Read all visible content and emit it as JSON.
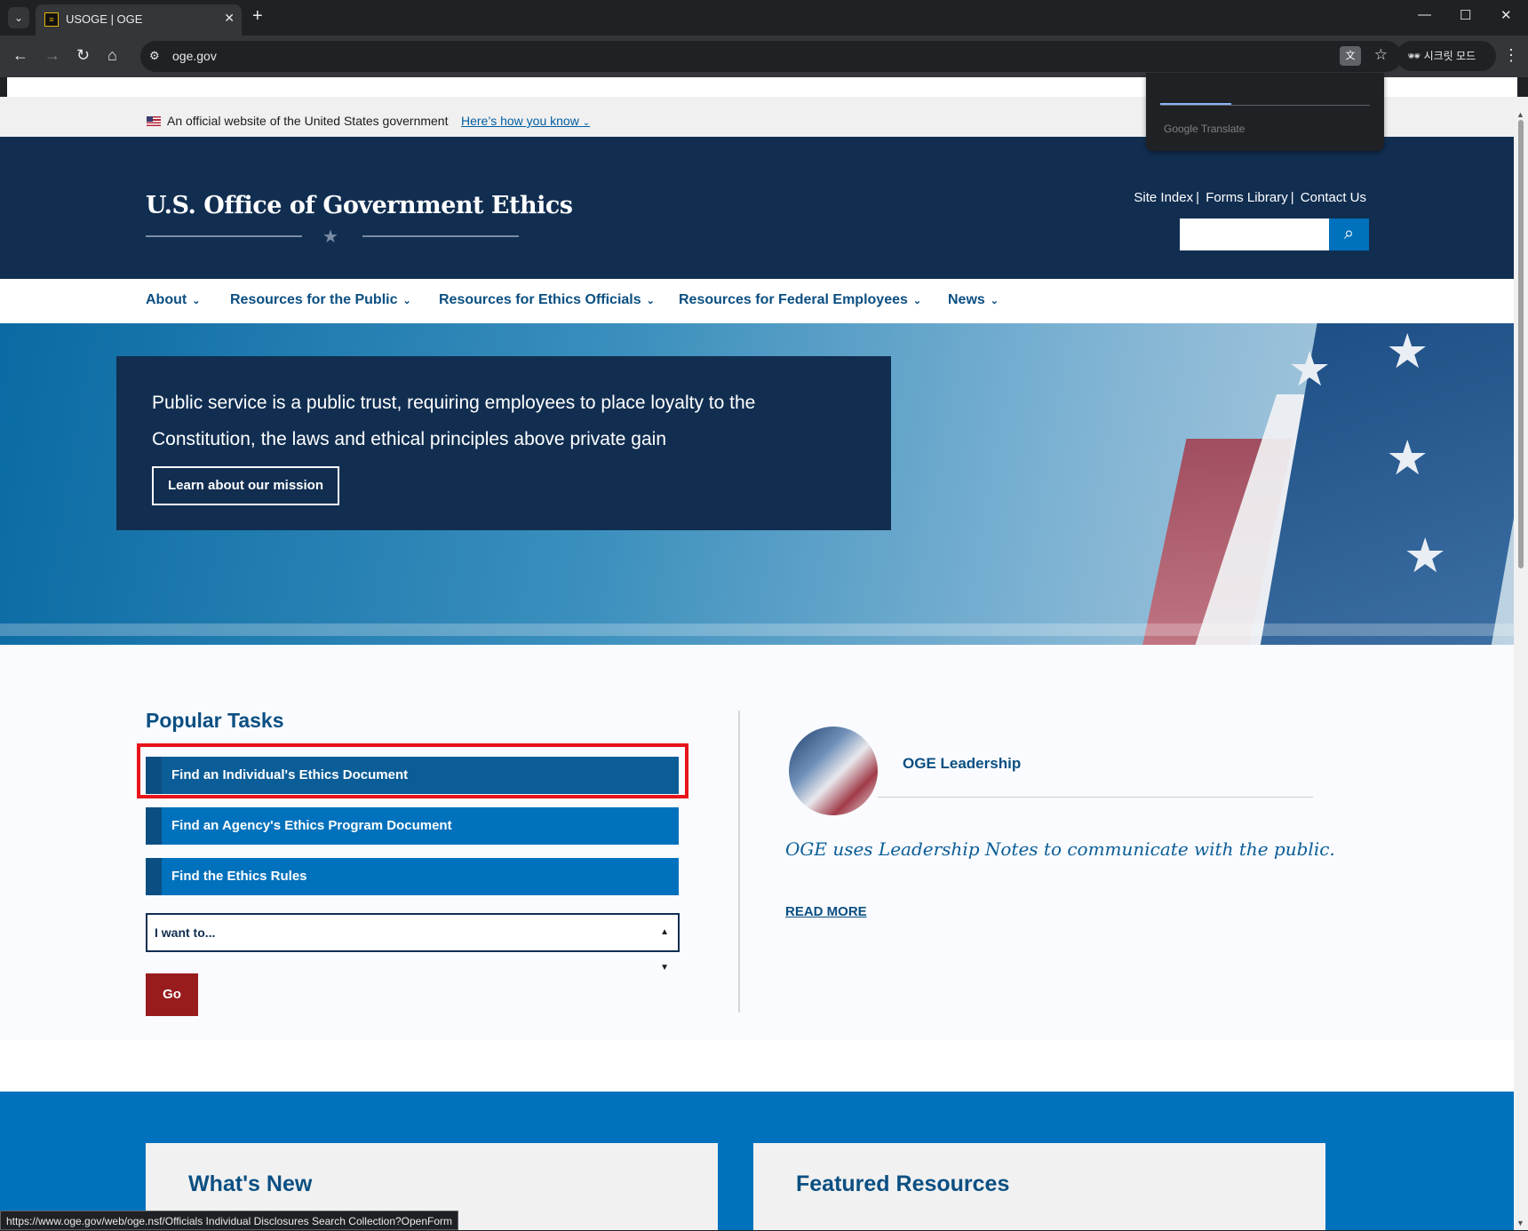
{
  "browser": {
    "tab_title": "USOGE | OGE",
    "url": "oge.gov",
    "profile_label": "시크릿 모드",
    "status_url": "https://www.oge.gov/web/oge.nsf/Officials Individual Disclosures Search Collection?OpenForm",
    "translate_brand": "Google Translate"
  },
  "gov_banner": {
    "text": "An official website of the United States government",
    "link": "Here’s how you know"
  },
  "header": {
    "site_title": "U.S. Office of Government Ethics",
    "util_links": [
      "Site Index",
      "Forms Library",
      "Contact Us"
    ],
    "search_placeholder": ""
  },
  "nav": {
    "items": [
      "About",
      "Resources for the Public",
      "Resources for Ethics Officials",
      "Resources for Federal Employees",
      "News"
    ]
  },
  "hero": {
    "quote": "Public service is a public trust, requiring employees to place loyalty to the Constitution, the laws and ethical principles above private gain",
    "button": "Learn about our mission"
  },
  "popular_tasks": {
    "title": "Popular Tasks",
    "tasks": [
      "Find an Individual's Ethics Document",
      "Find an Agency's Ethics Program Document",
      "Find the Ethics Rules"
    ],
    "select_value": "I want to...",
    "go_label": "Go"
  },
  "leadership": {
    "title": "OGE Leadership",
    "text": "OGE uses Leadership Notes to communicate with the public.",
    "read_more": "READ MORE"
  },
  "sections": {
    "whats_new": "What's New",
    "featured": "Featured Resources"
  },
  "colors": {
    "navy": "#112e51",
    "primary_blue": "#0071bc",
    "link_blue": "#0b4f82",
    "go_red": "#981b1e",
    "highlight_red": "#e8141b"
  }
}
